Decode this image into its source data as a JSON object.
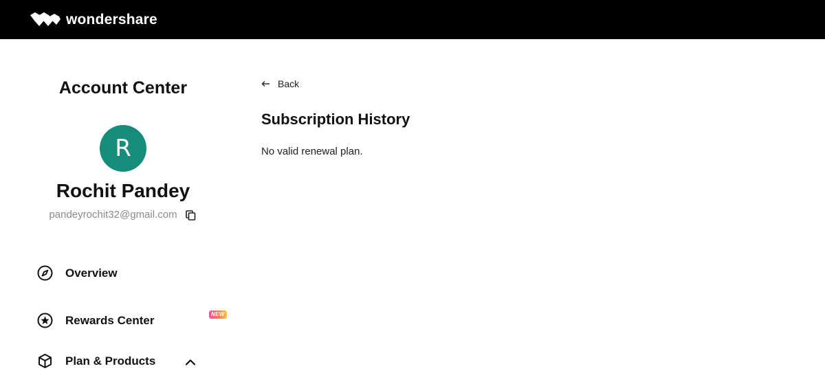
{
  "header": {
    "brand_name": "wondershare",
    "logo_icon": "wondershare-logo-icon",
    "background_color": "#000000"
  },
  "sidebar": {
    "title": "Account Center",
    "avatar": {
      "initial": "R",
      "color": "#168c7a"
    },
    "user_name": "Rochit Pandey",
    "email": "pandeyrochit32@gmail.com",
    "copy_icon": "copy-icon",
    "nav": [
      {
        "label": "Overview",
        "icon": "compass-icon"
      },
      {
        "label": "Rewards Center",
        "icon": "star-badge-icon",
        "badge": "NEW"
      },
      {
        "label": "Plan & Products",
        "icon": "box-icon",
        "expanded": true
      }
    ]
  },
  "main": {
    "back_label": "Back",
    "title": "Subscription History",
    "empty_message": "No valid renewal plan."
  }
}
